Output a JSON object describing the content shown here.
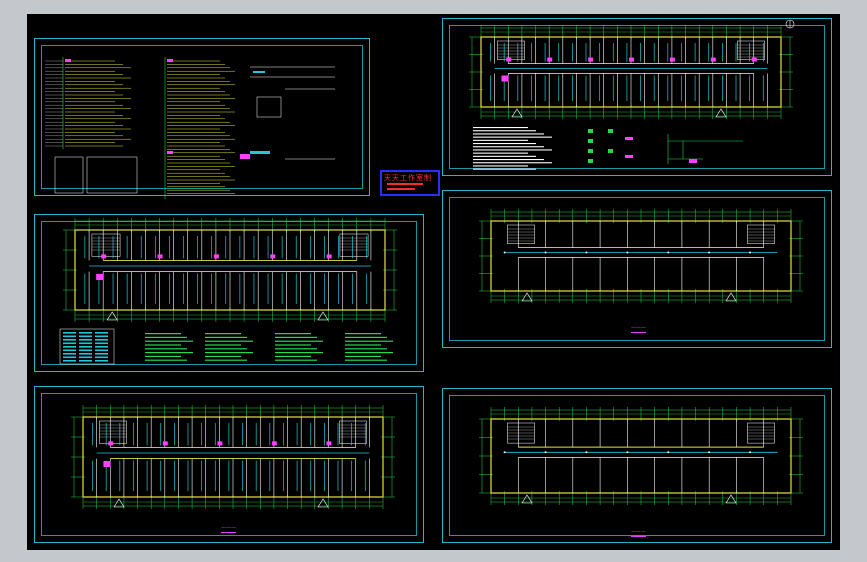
{
  "app": {
    "title": "",
    "background_color": "#c4c7cc",
    "canvas_color": "#000000"
  },
  "colors": {
    "frame": "#23b8c4",
    "wall": "#e6e23c",
    "grid": "#26d94a",
    "pipe": "#21c8d8",
    "fixture": "#ff40ff",
    "stamp_border": "#2233ff",
    "stamp_text": "#ff3030"
  },
  "title_stamp": {
    "text": "天天工作室制"
  },
  "sheets": [
    {
      "name": "system-diagram-sheet",
      "kind": "diagram"
    },
    {
      "name": "first-floor-plan-sheet",
      "kind": "plan",
      "label": ""
    },
    {
      "name": "second-floor-plan-sheet",
      "kind": "plan",
      "label": "———"
    },
    {
      "name": "roof-plan-sheet",
      "kind": "plan",
      "label": ""
    },
    {
      "name": "third-floor-plan-sheet",
      "kind": "plan",
      "label": "———"
    },
    {
      "name": "fourth-floor-plan-sheet",
      "kind": "plan",
      "label": "———"
    }
  ],
  "icons": {
    "north_arrow": "north-arrow-icon"
  }
}
